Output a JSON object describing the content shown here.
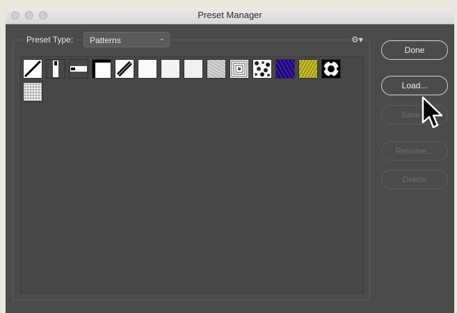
{
  "window": {
    "title": "Preset Manager"
  },
  "preset_type": {
    "label": "Preset Type:",
    "selected": "Patterns"
  },
  "buttons": {
    "done": "Done",
    "load": "Load...",
    "save_set": "Save S",
    "rename": "Rename...",
    "delete": "Delete"
  },
  "icons": {
    "gear": "gear-icon",
    "dropdown": "chevron-down-icon",
    "cursor": "mouse-pointer-icon"
  },
  "patterns": [
    "diagonal-line",
    "vertical-bar",
    "horizontal-bar",
    "corner",
    "thick-diagonal",
    "white-texture",
    "light-texture",
    "fine-noise",
    "coarse-noise",
    "concentric-squares",
    "blob-texture",
    "purple-texture",
    "yellow-texture",
    "black-white-ring",
    "gray-dots"
  ]
}
